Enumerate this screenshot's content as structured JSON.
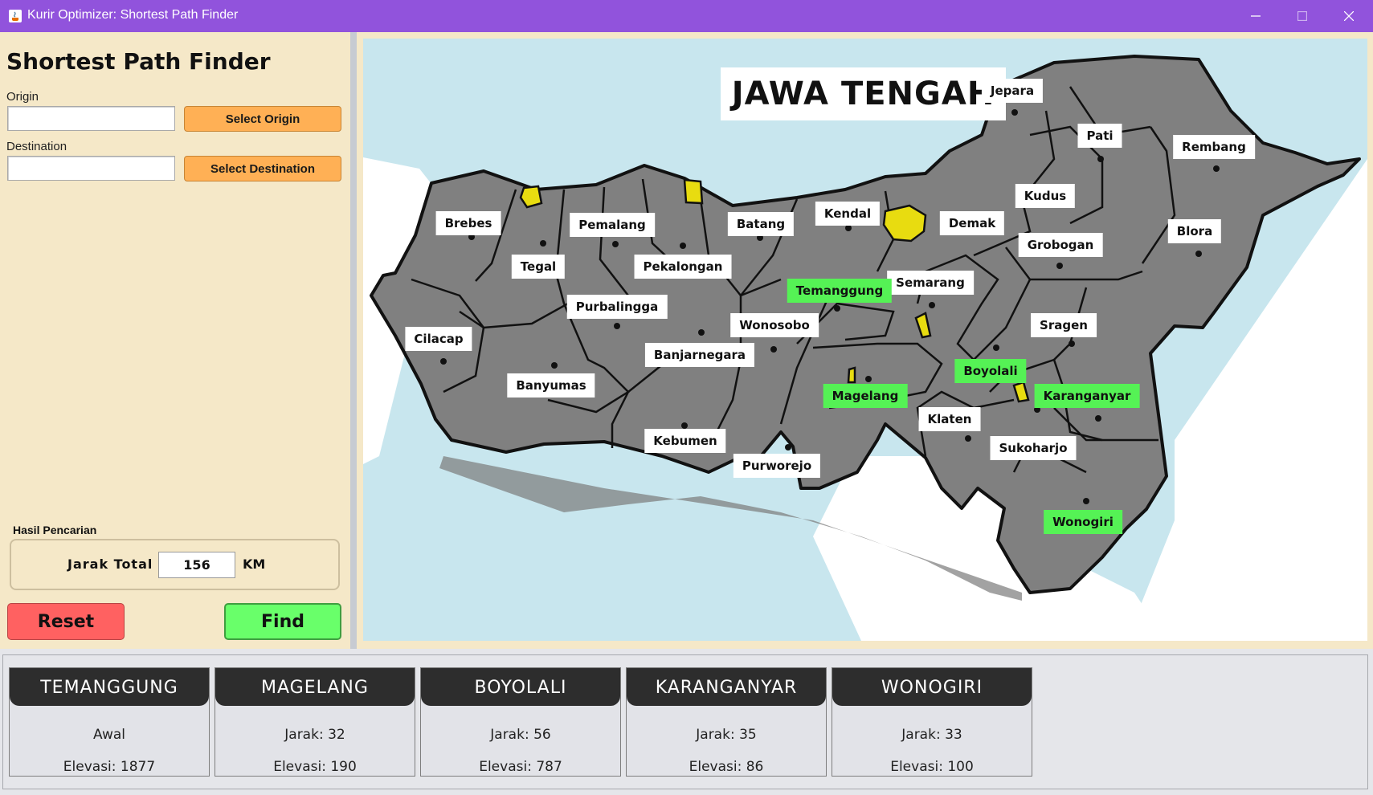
{
  "window": {
    "title": "Kurir Optimizer: Shortest Path Finder",
    "controls": [
      "minimize",
      "maximize",
      "close"
    ]
  },
  "sidebar": {
    "heading": "Shortest Path Finder",
    "origin": {
      "label": "Origin",
      "value": "",
      "button": "Select Origin"
    },
    "destination": {
      "label": "Destination",
      "value": "",
      "button": "Select Destination"
    },
    "result": {
      "title": "Hasil Pencarian",
      "label": "Jarak Total",
      "value": "156",
      "unit": "KM"
    },
    "reset_button": "Reset",
    "find_button": "Find"
  },
  "map": {
    "title": "JAWA TENGAH",
    "colors": {
      "sea": "#c8e6ee",
      "land": "#808080",
      "enclave": "#e8dc10",
      "highlight": "#55f255",
      "border": "#111111"
    },
    "cities": [
      {
        "name": "Jepara",
        "highlighted": false
      },
      {
        "name": "Pati",
        "highlighted": false
      },
      {
        "name": "Rembang",
        "highlighted": false
      },
      {
        "name": "Kudus",
        "highlighted": false
      },
      {
        "name": "Blora",
        "highlighted": false
      },
      {
        "name": "Demak",
        "highlighted": false
      },
      {
        "name": "Grobogan",
        "highlighted": false
      },
      {
        "name": "Kendal",
        "highlighted": false
      },
      {
        "name": "Semarang",
        "highlighted": false
      },
      {
        "name": "Temanggung",
        "highlighted": true
      },
      {
        "name": "Batang",
        "highlighted": false
      },
      {
        "name": "Pekalongan",
        "highlighted": false
      },
      {
        "name": "Pemalang",
        "highlighted": false
      },
      {
        "name": "Tegal",
        "highlighted": false
      },
      {
        "name": "Brebes",
        "highlighted": false
      },
      {
        "name": "Purbalingga",
        "highlighted": false
      },
      {
        "name": "Banjarnegara",
        "highlighted": false
      },
      {
        "name": "Wonosobo",
        "highlighted": false
      },
      {
        "name": "Cilacap",
        "highlighted": false
      },
      {
        "name": "Banyumas",
        "highlighted": false
      },
      {
        "name": "Kebumen",
        "highlighted": false
      },
      {
        "name": "Purworejo",
        "highlighted": false
      },
      {
        "name": "Magelang",
        "highlighted": true
      },
      {
        "name": "Boyolali",
        "highlighted": true
      },
      {
        "name": "Klaten",
        "highlighted": false
      },
      {
        "name": "Sragen",
        "highlighted": false
      },
      {
        "name": "Karanganyar",
        "highlighted": true
      },
      {
        "name": "Sukoharjo",
        "highlighted": false
      },
      {
        "name": "Wonogiri",
        "highlighted": true
      }
    ]
  },
  "path_cards": [
    {
      "name": "TEMANGGUNG",
      "line1": "Awal",
      "line2": "Elevasi: 1877"
    },
    {
      "name": "MAGELANG",
      "line1": "Jarak: 32",
      "line2": "Elevasi: 190"
    },
    {
      "name": "BOYOLALI",
      "line1": "Jarak: 56",
      "line2": "Elevasi: 787"
    },
    {
      "name": "KARANGANYAR",
      "line1": "Jarak: 35",
      "line2": "Elevasi: 86"
    },
    {
      "name": "WONOGIRI",
      "line1": "Jarak: 33",
      "line2": "Elevasi: 100"
    }
  ]
}
